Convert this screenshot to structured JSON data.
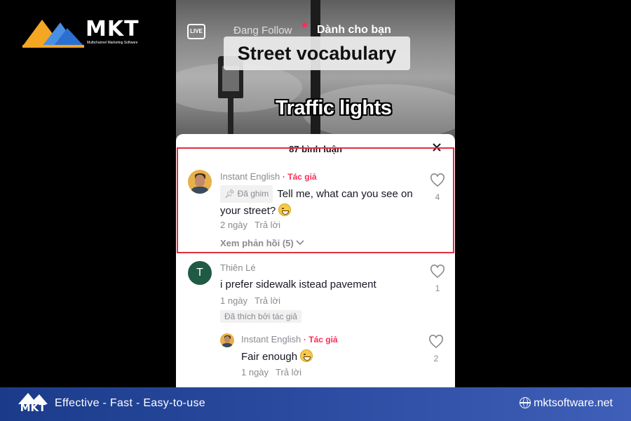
{
  "brand": {
    "logo_text": "MKT",
    "logo_subtext": "Multichannel Marketing Software",
    "tagline": "Effective - Fast - Easy-to-use",
    "website": "mktsoftware.net",
    "bottom_logo_text": "MKT"
  },
  "video": {
    "live_label": "LIVE",
    "tab_following": "Đang Follow",
    "tab_for_you": "Dành cho bạn",
    "caption_title": "Street vocabulary",
    "caption_subtitle": "Traffic lights"
  },
  "comments_panel": {
    "header": "87 bình luận",
    "comments": [
      {
        "username": "Instant English",
        "author_tag": "· Tác giả",
        "pinned_label": "Đã ghim",
        "text": "Tell me, what can you see on your street?",
        "age": "2 ngày",
        "reply_label": "Trả lời",
        "like_count": "4",
        "view_replies": "Xem phản hồi (5)"
      },
      {
        "avatar_letter": "T",
        "username": "Thiên Lé",
        "text": "i prefer sidewalk istead pavement",
        "age": "1 ngày",
        "reply_label": "Trả lời",
        "like_count": "1",
        "liked_by_author": "Đã thích bởi tác giả"
      },
      {
        "username": "Instant English",
        "author_tag": "· Tác giả",
        "text": "Fair enough",
        "age": "1 ngày",
        "reply_label": "Trả lời",
        "like_count": "2"
      }
    ]
  },
  "colors": {
    "highlight_border": "#e0303e",
    "author_tag": "#fe2c55",
    "bottom_bar": "#2a4aa0"
  }
}
